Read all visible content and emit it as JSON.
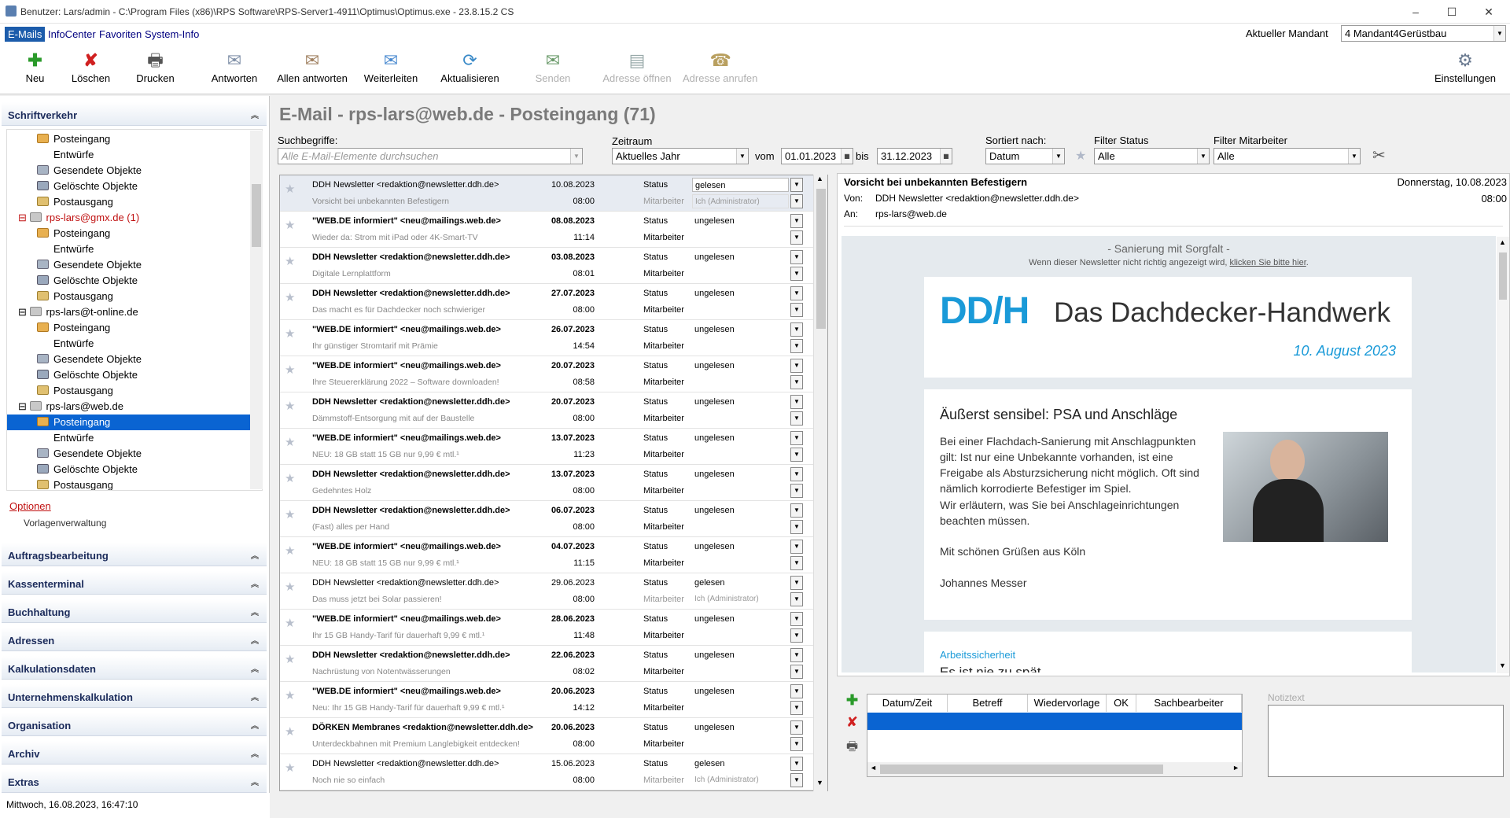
{
  "window": {
    "title": "Benutzer: Lars/admin - C:\\Program Files (x86)\\RPS Software\\RPS-Server1-4911\\Optimus\\Optimus.exe - 23.8.15.2 CS"
  },
  "menu": {
    "emails": "E-Mails",
    "infocenter": "InfoCenter",
    "favoriten": "Favoriten",
    "systeminfo": "System-Info",
    "mandant_label": "Aktueller Mandant",
    "mandant_value": "4 Mandant4Gerüstbau"
  },
  "toolbar": {
    "neu": "Neu",
    "loeschen": "Löschen",
    "drucken": "Drucken",
    "antworten": "Antworten",
    "allen": "Allen antworten",
    "weiter": "Weiterleiten",
    "aktual": "Aktualisieren",
    "senden": "Senden",
    "adr_oeffnen": "Adresse öffnen",
    "adr_anrufen": "Adresse anrufen",
    "einstellungen": "Einstellungen"
  },
  "sidebar": {
    "schriftverkehr": "Schriftverkehr",
    "tree": [
      "Posteingang",
      "Entwürfe",
      "Gesendete Objekte",
      "Gelöschte Objekte",
      "Postausgang",
      "rps-lars@gmx.de (1)",
      "Posteingang",
      "Entwürfe",
      "Gesendete Objekte",
      "Gelöschte Objekte",
      "Postausgang",
      "rps-lars@t-online.de",
      "Posteingang",
      "Entwürfe",
      "Gesendete Objekte",
      "Gelöschte Objekte",
      "Postausgang",
      "rps-lars@web.de",
      "Posteingang",
      "Entwürfe",
      "Gesendete Objekte",
      "Gelöschte Objekte",
      "Postausgang"
    ],
    "optionen": "Optionen",
    "vorlagen": "Vorlagenverwaltung",
    "sections": [
      "Auftragsbearbeitung",
      "Kassenterminal",
      "Buchhaltung",
      "Adressen",
      "Kalkulationsdaten",
      "Unternehmenskalkulation",
      "Organisation",
      "Archiv",
      "Extras"
    ],
    "status": "Mittwoch, 16.08.2023, 16:47:10"
  },
  "main": {
    "title": "E-Mail - rps-lars@web.de - Posteingang (71)"
  },
  "filters": {
    "such_label": "Suchbegriffe:",
    "such_ph": "Alle E-Mail-Elemente durchsuchen",
    "zeit_label": "Zeitraum",
    "zeit_value": "Aktuelles Jahr",
    "vom": "vom",
    "von_date": "01.01.2023",
    "bis": "bis",
    "bis_date": "31.12.2023",
    "sort_label": "Sortiert nach:",
    "sort_value": "Datum",
    "fstatus_label": "Filter Status",
    "fstatus_value": "Alle",
    "fmit_label": "Filter Mitarbeiter",
    "fmit_value": "Alle"
  },
  "list": {
    "status_label": "Status",
    "mit_label": "Mitarbeiter",
    "rows": [
      {
        "sender": "DDH Newsletter <redaktion@newsletter.ddh.de>",
        "subject": "Vorsicht bei unbekannten Befestigern",
        "date": "10.08.2023",
        "time": "08:00",
        "status": "gelesen",
        "mit": "Ich (Administrator)"
      },
      {
        "sender": "\"WEB.DE informiert\" <neu@mailings.web.de>",
        "subject": "Wieder da: Strom mit iPad oder 4K-Smart-TV",
        "date": "08.08.2023",
        "time": "11:14",
        "status": "ungelesen",
        "mit": ""
      },
      {
        "sender": "DDH Newsletter <redaktion@newsletter.ddh.de>",
        "subject": "Digitale Lernplattform",
        "date": "03.08.2023",
        "time": "08:01",
        "status": "ungelesen",
        "mit": ""
      },
      {
        "sender": "DDH Newsletter <redaktion@newsletter.ddh.de>",
        "subject": "Das macht es für Dachdecker noch schwieriger",
        "date": "27.07.2023",
        "time": "08:00",
        "status": "ungelesen",
        "mit": ""
      },
      {
        "sender": "\"WEB.DE informiert\" <neu@mailings.web.de>",
        "subject": "Ihr günstiger Stromtarif mit Prämie",
        "date": "26.07.2023",
        "time": "14:54",
        "status": "ungelesen",
        "mit": ""
      },
      {
        "sender": "\"WEB.DE informiert\" <neu@mailings.web.de>",
        "subject": "Ihre Steuererklärung 2022 – Software downloaden!",
        "date": "20.07.2023",
        "time": "08:58",
        "status": "ungelesen",
        "mit": ""
      },
      {
        "sender": "DDH Newsletter <redaktion@newsletter.ddh.de>",
        "subject": "Dämmstoff-Entsorgung mit auf der Baustelle",
        "date": "20.07.2023",
        "time": "08:00",
        "status": "ungelesen",
        "mit": ""
      },
      {
        "sender": "\"WEB.DE informiert\" <neu@mailings.web.de>",
        "subject": "NEU: 18 GB statt 15 GB nur 9,99 € mtl.¹",
        "date": "13.07.2023",
        "time": "11:23",
        "status": "ungelesen",
        "mit": ""
      },
      {
        "sender": "DDH Newsletter <redaktion@newsletter.ddh.de>",
        "subject": "Gedehntes Holz",
        "date": "13.07.2023",
        "time": "08:00",
        "status": "ungelesen",
        "mit": ""
      },
      {
        "sender": "DDH Newsletter <redaktion@newsletter.ddh.de>",
        "subject": "(Fast) alles per Hand",
        "date": "06.07.2023",
        "time": "08:00",
        "status": "ungelesen",
        "mit": ""
      },
      {
        "sender": "\"WEB.DE informiert\" <neu@mailings.web.de>",
        "subject": "NEU: 18 GB statt 15 GB nur 9,99 € mtl.¹",
        "date": "04.07.2023",
        "time": "11:15",
        "status": "ungelesen",
        "mit": ""
      },
      {
        "sender": "DDH Newsletter <redaktion@newsletter.ddh.de>",
        "subject": "Das muss jetzt bei Solar passieren!",
        "date": "29.06.2023",
        "time": "08:00",
        "status": "gelesen",
        "mit": "Ich (Administrator)"
      },
      {
        "sender": "\"WEB.DE informiert\" <neu@mailings.web.de>",
        "subject": "Ihr 15 GB Handy-Tarif für dauerhaft 9,99 € mtl.¹",
        "date": "28.06.2023",
        "time": "11:48",
        "status": "ungelesen",
        "mit": ""
      },
      {
        "sender": "DDH Newsletter <redaktion@newsletter.ddh.de>",
        "subject": "Nachrüstung von Notentwässerungen",
        "date": "22.06.2023",
        "time": "08:02",
        "status": "ungelesen",
        "mit": ""
      },
      {
        "sender": "\"WEB.DE informiert\" <neu@mailings.web.de>",
        "subject": "Neu: Ihr 15 GB Handy-Tarif für dauerhaft 9,99 € mtl.¹",
        "date": "20.06.2023",
        "time": "14:12",
        "status": "ungelesen",
        "mit": ""
      },
      {
        "sender": "DÖRKEN Membranes <redaktion@newsletter.ddh.de>",
        "subject": "Unterdeckbahnen mit Premium Langlebigkeit entdecken!",
        "date": "20.06.2023",
        "time": "08:00",
        "status": "ungelesen",
        "mit": ""
      },
      {
        "sender": "DDH Newsletter <redaktion@newsletter.ddh.de>",
        "subject": "Noch nie so einfach",
        "date": "15.06.2023",
        "time": "08:00",
        "status": "gelesen",
        "mit": "Ich (Administrator)"
      }
    ]
  },
  "preview": {
    "subject": "Vorsicht bei unbekannten Befestigern",
    "date": "Donnerstag, 10.08.2023",
    "time": "08:00",
    "von_label": "Von:",
    "von": "DDH Newsletter <redaktion@newsletter.ddh.de>",
    "an_label": "An:",
    "an": "rps-lars@web.de",
    "nl_tagline": "- Sanierung mit Sorgfalt -",
    "nl_notice": "Wenn dieser Newsletter nicht richtig angezeigt wird,",
    "nl_notice_link": "klicken Sie bitte hier",
    "nl_logo": "DD/H",
    "nl_brand": "Das Dachdecker-Handwerk",
    "nl_date": "10. August 2023",
    "art_title": "Äußerst sensibel: PSA und Anschläge",
    "art_p1": "Bei einer Flachdach-Sanierung mit Anschlagpunkten gilt: Ist nur eine Unbekannte vorhanden, ist eine Freigabe als Absturzsicherung nicht möglich. Oft sind nämlich korrodierte Befestiger im Spiel.",
    "art_p2": "Wir erläutern, was Sie bei Anschlageinrichtungen beachten müssen.",
    "art_greet": "Mit schönen Grüßen aus Köln",
    "art_sig": "Johannes Messer",
    "sec2_kicker": "Arbeitssicherheit",
    "sec2_title": "Es ist nie zu spät"
  },
  "notes": {
    "cols": [
      "Datum/Zeit",
      "Betreff",
      "Wiedervorlage",
      "OK",
      "Sachbearbeiter"
    ],
    "notiz_label": "Notiztext"
  }
}
